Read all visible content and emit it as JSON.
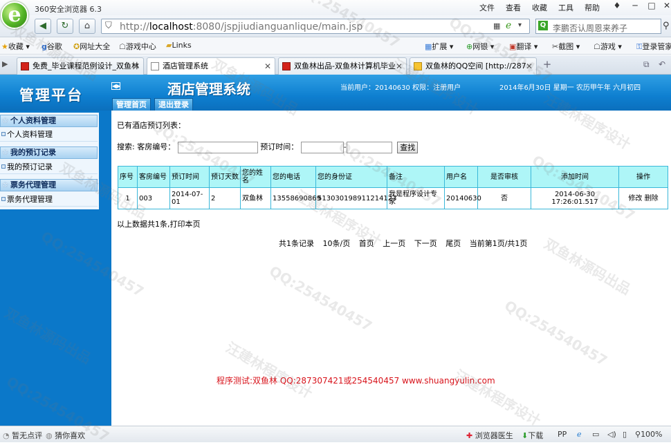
{
  "browser": {
    "title": "360安全浏览器 6.3",
    "menu": [
      "文件",
      "查看",
      "收藏",
      "工具",
      "帮助"
    ],
    "url_scheme": "http://",
    "url_host": "localhost",
    "url_rest": ":8080/jspjiudianguanlique/main.jsp",
    "search_text": "李鹏否认周恩来养子",
    "bookmarks_left": [
      "收藏",
      "谷歌",
      "网址大全",
      "游戏中心",
      "Links"
    ],
    "bookmarks_right": [
      "扩展",
      "网银",
      "翻译",
      "截图",
      "游戏",
      "登录管家"
    ],
    "tabs": [
      {
        "label": "免费_毕业课程范例设计_双鱼林"
      },
      {
        "label": "酒店管理系统"
      },
      {
        "label": "双鱼林出品-双鱼林计算机毕业"
      },
      {
        "label": "双鱼林的QQ空间 [http://287"
      }
    ],
    "status_left": [
      "暂无点评",
      "猜你喜欢"
    ],
    "status_right": [
      "浏览器医生",
      "下载",
      "100%"
    ]
  },
  "app": {
    "platform_title": "管理平台",
    "system_title": "酒店管理系统",
    "user_info": "当前用户：20140630  权限：注册用户",
    "date_info": "2014年6月30日 星期一 农历甲午年 六月初四",
    "header_tabs": [
      "管理首页",
      "退出登录"
    ]
  },
  "sidebar": {
    "sections": [
      {
        "title": "个人资料管理",
        "item": "个人资料管理"
      },
      {
        "title": "我的预订记录",
        "item": "我的预订记录"
      },
      {
        "title": "票务代理管理",
        "item": "票务代理管理"
      }
    ]
  },
  "main": {
    "list_title": "已有酒店预订列表：",
    "search_label": "搜索:",
    "room_no_label": "客房编号：",
    "time_label": "预订时间：",
    "dash": "-",
    "search_button": "查找",
    "columns": [
      "序号",
      "客房编号",
      "预订时间",
      "预订天数",
      "您的姓名",
      "您的电话",
      "您的身份证",
      "备注",
      "用户名",
      "是否审核",
      "添加时间",
      "操作"
    ],
    "rows": [
      {
        "seq": "1",
        "room": "003",
        "date": "2014-07-01",
        "days": "2",
        "name": "双鱼林",
        "phone": "13558690869",
        "idcard": "513030198911214123",
        "remark": "我是程序设计专家",
        "username": "20140630",
        "audited": "否",
        "added": "2014-06-30 17:26:01.517",
        "edit": "修改",
        "delete": "删除"
      }
    ],
    "summary": "以上数据共1条,打印本页",
    "pager": [
      "共1条记录",
      "10条/页",
      "首页",
      "上一页",
      "下一页",
      "尾页",
      "当前第1页/共1页"
    ],
    "credit": "程序测试:双鱼林 QQ:287307421或254540457 www.shuangyulin.com"
  },
  "watermarks": [
    "QQ:254540457",
    "双鱼林源码出品",
    "汪建林程序设计"
  ]
}
